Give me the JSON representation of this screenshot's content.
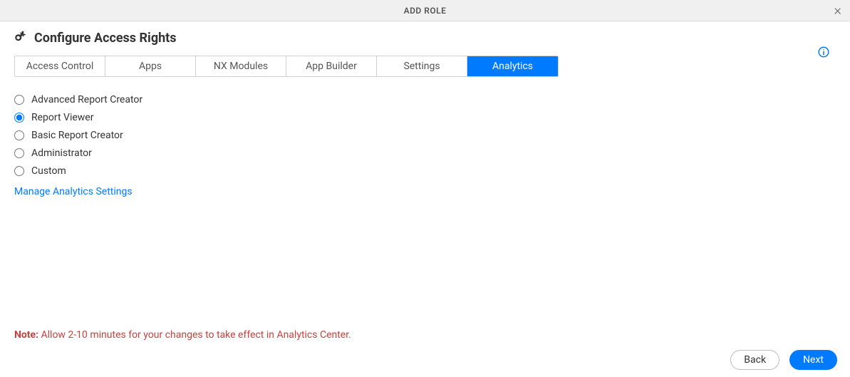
{
  "header": {
    "title": "ADD ROLE"
  },
  "section": {
    "title": "Configure Access Rights"
  },
  "tabs": [
    {
      "label": "Access Control",
      "active": false
    },
    {
      "label": "Apps",
      "active": false
    },
    {
      "label": "NX Modules",
      "active": false
    },
    {
      "label": "App Builder",
      "active": false
    },
    {
      "label": "Settings",
      "active": false
    },
    {
      "label": "Analytics",
      "active": true
    }
  ],
  "options": [
    {
      "label": "Advanced Report Creator",
      "selected": false
    },
    {
      "label": "Report Viewer",
      "selected": true
    },
    {
      "label": "Basic Report Creator",
      "selected": false
    },
    {
      "label": "Administrator",
      "selected": false
    },
    {
      "label": "Custom",
      "selected": false
    }
  ],
  "manage_link": "Manage Analytics Settings",
  "note": {
    "label": "Note:",
    "text": " Allow 2-10 minutes for your changes to take effect in Analytics Center."
  },
  "buttons": {
    "back": "Back",
    "next": "Next"
  }
}
